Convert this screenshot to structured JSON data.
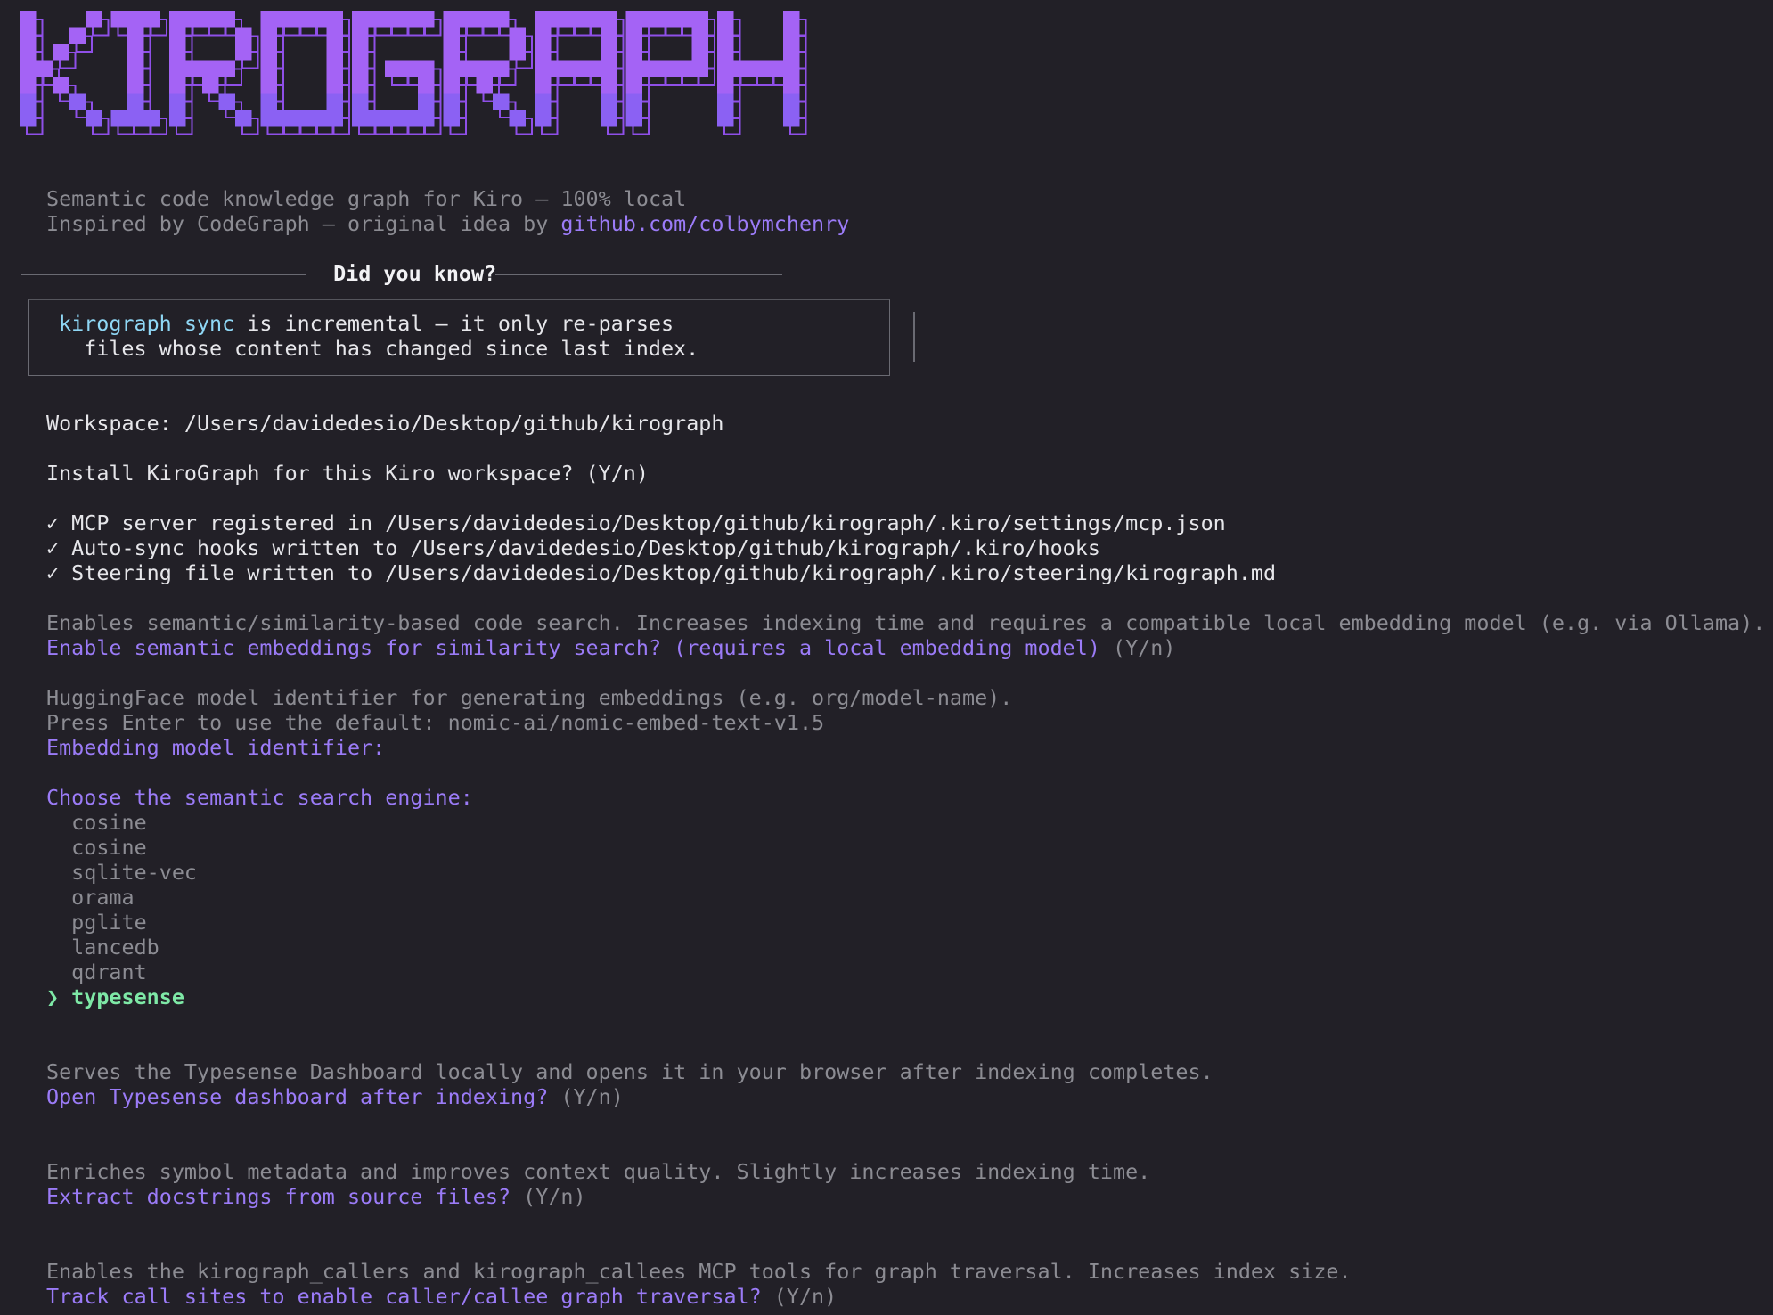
{
  "logo": {
    "text": "KIROGRAPH",
    "colors": {
      "fill": "#a463f5",
      "lower": "#8b61f3",
      "outline": "#8f4fe8"
    }
  },
  "header": {
    "subtitle": "Semantic code knowledge graph for Kiro — 100% local",
    "inspired_prefix": "Inspired by CodeGraph — original idea by ",
    "inspired_link": "github.com/colbymchenry"
  },
  "tip": {
    "title": " Did you know? ",
    "command_a": "kirograph",
    "command_b": "sync",
    "line1_rest": " is incremental — it only re-parses",
    "line2": "  files whose content has changed since last index."
  },
  "workspace": {
    "label": "Workspace: ",
    "path": "/Users/davidedesio/Desktop/github/kirograph"
  },
  "install_prompt": "Install KiroGraph for this Kiro workspace? (Y/n)",
  "results": [
    "✓ MCP server registered in /Users/davidedesio/Desktop/github/kirograph/.kiro/settings/mcp.json",
    "✓ Auto-sync hooks written to /Users/davidedesio/Desktop/github/kirograph/.kiro/hooks",
    "✓ Steering file written to /Users/davidedesio/Desktop/github/kirograph/.kiro/steering/kirograph.md"
  ],
  "semantic": {
    "description": "Enables semantic/similarity-based code search. Increases indexing time and requires a compatible local embedding model (e.g. via Ollama).",
    "question": "Enable semantic embeddings for similarity search? (requires a local embedding model)",
    "hint": " (Y/n)"
  },
  "model": {
    "description1": "HuggingFace model identifier for generating embeddings (e.g. org/model-name).",
    "description2": "Press Enter to use the default: nomic-ai/nomic-embed-text-v1.5",
    "question": "Embedding model identifier:"
  },
  "engine": {
    "question": "Choose the semantic search engine:",
    "options": [
      "  cosine",
      "  cosine",
      "  sqlite-vec",
      "  orama",
      "  pglite",
      "  lancedb",
      "  qdrant"
    ],
    "selected_marker": "❯ ",
    "selected": "typesense"
  },
  "dashboard": {
    "description": "Serves the Typesense Dashboard locally and opens it in your browser after indexing completes.",
    "question": "Open Typesense dashboard after indexing?",
    "hint": " (Y/n)"
  },
  "docstrings": {
    "description": "Enriches symbol metadata and improves context quality. Slightly increases indexing time.",
    "question": "Extract docstrings from source files?",
    "hint": " (Y/n)"
  },
  "callsites": {
    "description": "Enables the kirograph_callers and kirograph_callees MCP tools for graph traversal. Increases index size.",
    "question": "Track call sites to enable caller/callee graph traversal?",
    "hint": " (Y/n)"
  }
}
